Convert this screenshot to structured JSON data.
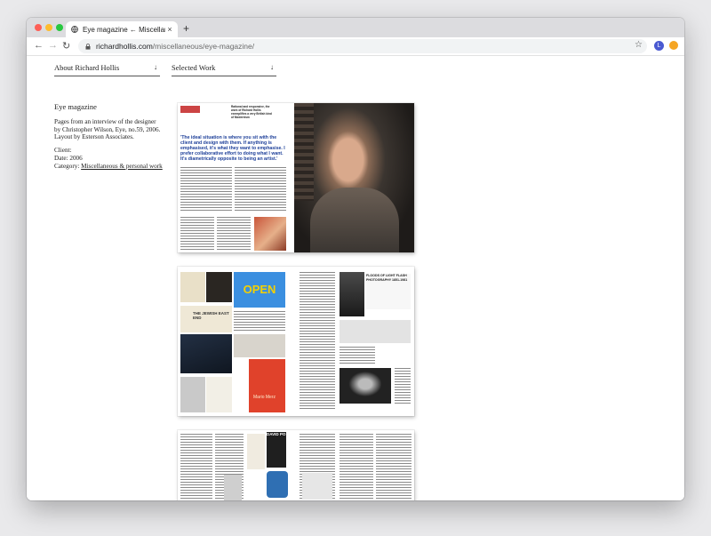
{
  "browser": {
    "tab_title": "Eye magazine ← Miscellaneous",
    "tab_close": "×",
    "new_tab": "+",
    "url_host": "richardhollis.com",
    "url_path": "/miscellaneous/eye-magazine/",
    "avatar_letter": "L",
    "back": "←",
    "forward": "→",
    "reload": "↻",
    "star": "☆"
  },
  "nav": {
    "about_label": "About Richard Hollis",
    "work_label": "Selected Work",
    "arrow": "↓"
  },
  "project": {
    "title": "Eye magazine",
    "desc_lines": [
      "Pages from an interview of the designer",
      "by Christopher Wilson, Eye, no.59, 2006.",
      "Layout by Esterson Associates."
    ],
    "client": "Client:",
    "date": "Date: 2006",
    "category_label": "Category: ",
    "category_link": "Miscellaneous & personal work"
  },
  "spread1": {
    "kicker": "Rational and responsive, the work of Richard Hollis exemplifies a very British kind of Modernism",
    "headline": "'The ideal situation is where you sit with the client and design with them. If anything is emphasised, it's what they want to emphasise. I prefer collaborative effort to doing what I want. It's diametrically opposite to being an artist.'"
  },
  "spread2": {
    "poster_open": "OPEN",
    "poster_jewish": "THE JEWISH EAST END",
    "poster_merz": "Mario Merz",
    "caption": "FLOODS OF LIGHT FLASH PHOTOGRAPHY 1851-1981"
  },
  "spread3": {
    "poster_text": "DAVID PO"
  },
  "colors": {
    "headline_blue": "#1d3f99",
    "open_blue": "#3b8fe0",
    "open_yellow": "#f5d000",
    "merz_red": "#e0422b"
  }
}
